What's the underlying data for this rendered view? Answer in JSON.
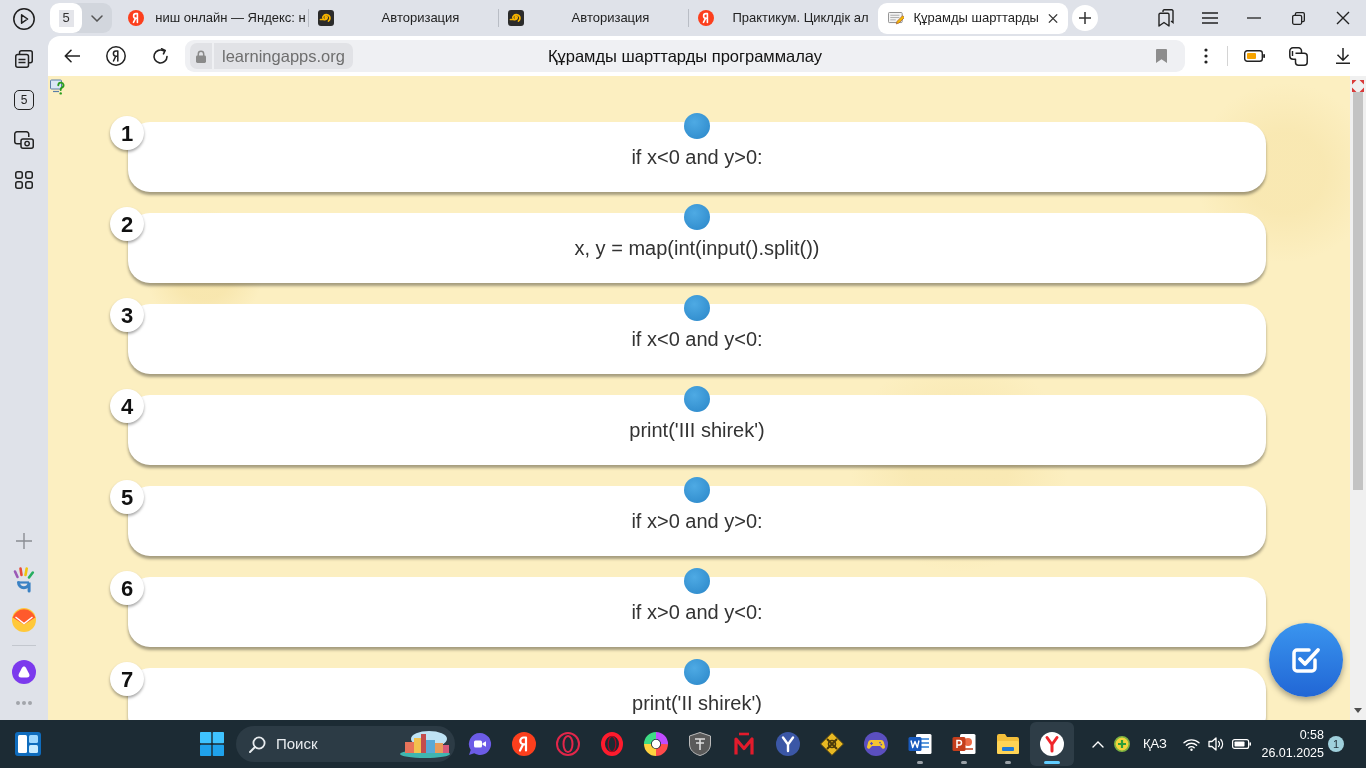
{
  "tab_strip": {
    "tab_count": "5",
    "tabs": [
      {
        "kind": "letter",
        "title": "ниш онлайн — Яндекс: н",
        "selected": false
      },
      {
        "kind": "spiral",
        "title": "Авторизация",
        "selected": false
      },
      {
        "kind": "spiral",
        "title": "Авторизация",
        "selected": false
      },
      {
        "kind": "letter",
        "title": "Практикум. Циклдік ал",
        "selected": false
      },
      {
        "kind": "notepad",
        "title": "Құрамды шарттарды",
        "selected": true
      }
    ]
  },
  "address_bar": {
    "domain": "learningapps.org",
    "page_title": "Құрамды шарттарды программалау"
  },
  "sidebar": {
    "tab_count": "5"
  },
  "exercise": {
    "cards": [
      {
        "number": "1",
        "text": "if x<0 and y>0:"
      },
      {
        "number": "2",
        "text": "x, y = map(int(input().split())"
      },
      {
        "number": "3",
        "text": "if x<0 and y<0:"
      },
      {
        "number": "4",
        "text": "print('III shirek')"
      },
      {
        "number": "5",
        "text": "if x>0 and y>0:"
      },
      {
        "number": "6",
        "text": "if x>0 and y<0:"
      },
      {
        "number": "7",
        "text": "print('II shirek')"
      }
    ]
  },
  "taskbar": {
    "search": {
      "label": "Поиск"
    },
    "apps": [
      {
        "kind": "camera-bubble",
        "running": false,
        "selected": false
      },
      {
        "kind": "red-letter",
        "running": false,
        "selected": false
      },
      {
        "kind": "ring",
        "running": false,
        "selected": false
      },
      {
        "kind": "red-ring",
        "running": false,
        "selected": false
      },
      {
        "kind": "wheel",
        "running": false,
        "selected": false
      },
      {
        "kind": "shield",
        "running": false,
        "selected": false
      },
      {
        "kind": "m",
        "running": false,
        "selected": false
      },
      {
        "kind": "y-circle",
        "running": false,
        "selected": false
      },
      {
        "kind": "diamond",
        "running": false,
        "selected": false
      },
      {
        "kind": "gamepad",
        "running": false,
        "selected": false
      },
      {
        "kind": "doc-w",
        "running": true,
        "selected": false
      },
      {
        "kind": "slides",
        "running": true,
        "selected": false
      },
      {
        "kind": "folder",
        "running": true,
        "selected": false
      },
      {
        "kind": "y-white",
        "running": true,
        "selected": true
      }
    ],
    "language": "ҚАЗ",
    "time": "0:58",
    "date": "26.01.2025",
    "notifications": "1"
  }
}
